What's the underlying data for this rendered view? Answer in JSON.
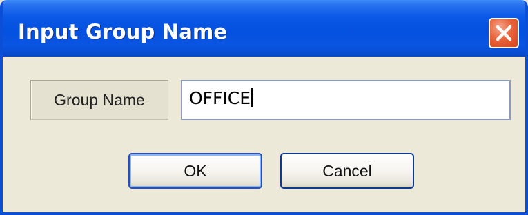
{
  "dialog": {
    "title": "Input Group Name",
    "close_icon": "close-icon"
  },
  "form": {
    "label": "Group Name",
    "group_name_value": "OFFICE"
  },
  "buttons": {
    "ok_label": "OK",
    "cancel_label": "Cancel"
  },
  "colors": {
    "titlebar": "#0551df",
    "dialog_bg": "#ece9d8",
    "close_button": "#e8643c"
  }
}
